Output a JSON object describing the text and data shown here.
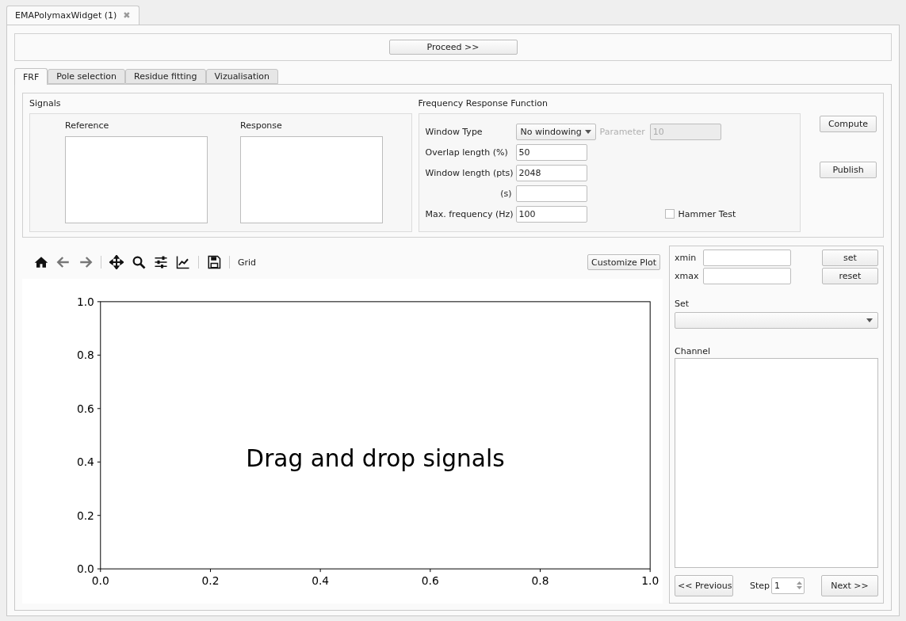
{
  "document_tab": {
    "title": "EMAPolymaxWidget (1)",
    "close": "✖"
  },
  "proceed_button": "Proceed >>",
  "tabs": [
    {
      "label": "FRF",
      "selected": true
    },
    {
      "label": "Pole selection",
      "selected": false
    },
    {
      "label": "Residue fitting",
      "selected": false
    },
    {
      "label": "Vizualisation",
      "selected": false
    }
  ],
  "signals": {
    "title": "Signals",
    "lists": [
      "Reference",
      "Response"
    ]
  },
  "frf": {
    "title": "Frequency Response Function",
    "window_type": {
      "label": "Window Type",
      "value": "No windowing"
    },
    "parameter": {
      "label": "Parameter",
      "value": "10",
      "disabled": true
    },
    "fields": [
      {
        "label": "Overlap length (%)",
        "value": "50"
      },
      {
        "label": "Window length (pts)",
        "value": "2048"
      },
      {
        "label": "(s)"
      },
      {
        "label": "Max. frequency (Hz)",
        "value": "100"
      }
    ],
    "hammer_test": {
      "label": "Hammer Test",
      "checked": false
    },
    "buttons": [
      "Compute",
      "Publish"
    ]
  },
  "toolbar": {
    "grid_label": "Grid",
    "customize_button": "Customize Plot"
  },
  "plot": {
    "chart_data": {
      "type": "line",
      "xlim": [
        0,
        1
      ],
      "ylim": [
        0,
        1
      ],
      "xticks": [
        {
          "value": 0,
          "label": "0.0"
        },
        {
          "value": 0.2,
          "label": "0.2"
        },
        {
          "value": 0.4,
          "label": "0.4"
        },
        {
          "value": 0.6,
          "label": "0.6"
        },
        {
          "value": 0.8,
          "label": "0.8"
        },
        {
          "value": 1,
          "label": "1.0"
        }
      ],
      "yticks": [
        {
          "value": 0,
          "label": "0.0"
        },
        {
          "value": 0.2,
          "label": "0.2"
        },
        {
          "value": 0.4,
          "label": "0.4"
        },
        {
          "value": 0.6,
          "label": "0.6"
        },
        {
          "value": 0.8,
          "label": "0.8"
        },
        {
          "value": 1,
          "label": "1.0"
        }
      ],
      "annotations": [
        "Drag and drop signals"
      ]
    }
  },
  "side": {
    "xmin_label": "xmin",
    "xmax_label": "xmax",
    "set_button": "set",
    "reset_button": "reset",
    "set_label": "Set",
    "channel_label": "Channel",
    "previous_button": "<< Previous",
    "step_label": "Step",
    "step_value": "1",
    "next_button": "Next >>"
  }
}
